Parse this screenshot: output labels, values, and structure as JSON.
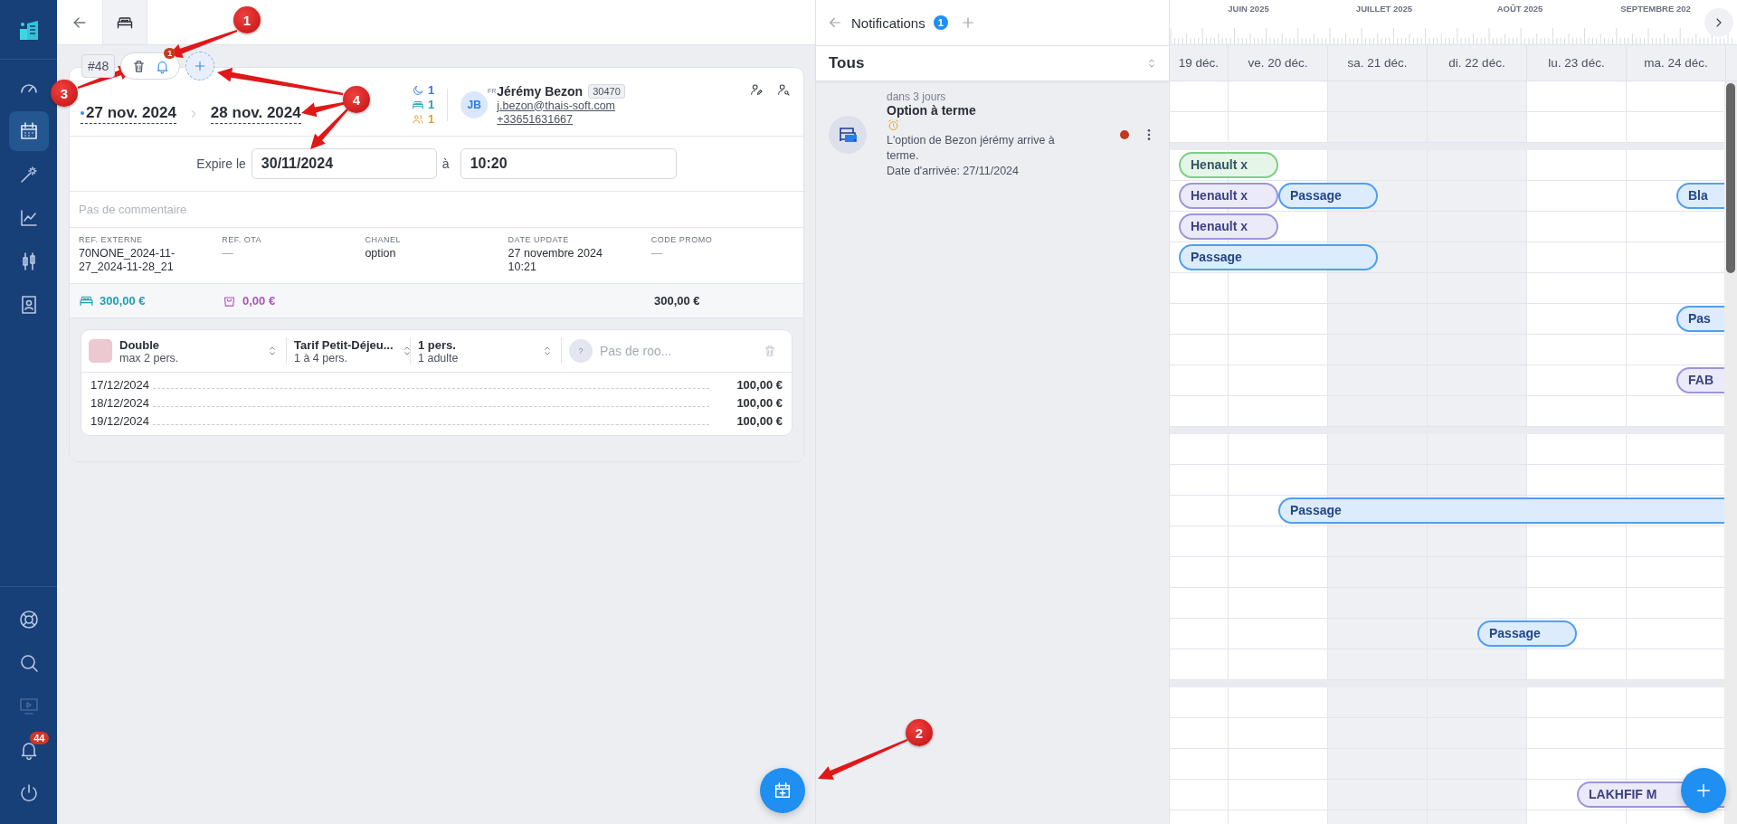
{
  "sidebar": {
    "top": [
      {
        "selected": false
      },
      {
        "selected": true
      },
      {
        "selected": false
      },
      {
        "selected": false
      },
      {
        "selected": false
      },
      {
        "selected": false
      }
    ],
    "bottom": [
      {
        "disabled": false
      },
      {
        "disabled": false
      },
      {
        "disabled": true
      },
      {
        "disabled": false,
        "badge": "44"
      },
      {
        "disabled": false
      }
    ]
  },
  "tabs": [
    {
      "selected": true
    }
  ],
  "booking": {
    "number": "#48",
    "alert_count": "1",
    "arrival": "27 nov. 2024",
    "departure": "28 nov. 2024",
    "nights": "1",
    "rooms": "1",
    "guests": "1",
    "guest": {
      "initials": "JB",
      "country": "FR",
      "name": "Jérémy Bezon",
      "id": "30470",
      "email": "j.bezon@thais-soft.com",
      "phone": "+33651631667"
    },
    "expiry": {
      "label": "Expire le",
      "date": "30/11/2024",
      "at": "à",
      "time": "10:20"
    },
    "comment": {
      "placeholder": "Pas de commentaire"
    },
    "refs": [
      {
        "label": "REF. EXTERNE",
        "value": "70NONE_2024-11-27_2024-11-28_21",
        "muted": false
      },
      {
        "label": "REF. OTA",
        "value": "—",
        "muted": true
      },
      {
        "label": "CHANEL",
        "value": "option",
        "muted": false
      },
      {
        "label": "DATE UPDATE",
        "value": "27 novembre 2024 10:21",
        "muted": false
      },
      {
        "label": "CODE PROMO",
        "value": "—",
        "muted": true
      }
    ],
    "totals": {
      "rooms": "300,00 €",
      "extras": "0,00 €",
      "total": "300,00 €"
    },
    "room_lines": [
      {
        "type": "Double",
        "capacity": "max 2 pers.",
        "rate": "Tarif Petit-Déjeu...",
        "rate_capacity": "1 à 4 pers.",
        "occupancy": "1 pers.",
        "occupancy_detail": "1 adulte",
        "room_mark": "?",
        "room_placeholder": "Pas de roo...",
        "nights": [
          {
            "date": "17/12/2024",
            "price": "100,00 €"
          },
          {
            "date": "18/12/2024",
            "price": "100,00 €"
          },
          {
            "date": "19/12/2024",
            "price": "100,00 €"
          }
        ]
      }
    ]
  },
  "notifications": {
    "title": "Notifications",
    "count": "1",
    "filter": "Tous",
    "items": [
      {
        "when": "dans 3 jours",
        "title": "Option à terme",
        "text": "L'option de Bezon jérémy arrive à terme.",
        "detail": "Date d'arrivée: 27/11/2024",
        "unread": true
      }
    ]
  },
  "calendar": {
    "months": [
      "JUIN 2025",
      "JUILLET 2025",
      "AOÛT 2025",
      "SEPTEMBRE 202"
    ],
    "days": [
      {
        "label": "19 déc.",
        "weekend": false
      },
      {
        "label": "ve. 20 déc.",
        "weekend": false
      },
      {
        "label": "sa. 21 déc.",
        "weekend": true
      },
      {
        "label": "di. 22 déc.",
        "weekend": true
      },
      {
        "label": "lu. 23 déc.",
        "weekend": false
      },
      {
        "label": "ma. 24 déc.",
        "weekend": false
      }
    ],
    "groups": [
      {
        "rows": [
          {},
          {}
        ]
      },
      {
        "rows": [
          {
            "bars": [
              {
                "label": "Henault x",
                "color": "#7ccf86"
              }
            ]
          },
          {
            "bars": [
              {
                "label": "Henault x",
                "color": "#9d95dc"
              },
              {
                "label": "Passage",
                "color": "#4f9ff0"
              },
              {
                "label": "Bla",
                "color": "#4f9ff0"
              }
            ]
          },
          {
            "bars": [
              {
                "label": "Henault x",
                "color": "#9d95dc"
              }
            ]
          },
          {
            "bars": [
              {
                "label": "Passage",
                "color": "#4f9ff0"
              }
            ]
          },
          {},
          {
            "bars": [
              {
                "label": "Pas",
                "color": "#4f9ff0"
              }
            ]
          },
          {},
          {
            "bars": [
              {
                "label": "FAB",
                "color": "#9d95dc"
              }
            ]
          },
          {}
        ]
      },
      {
        "rows": [
          {},
          {},
          {
            "bars": [
              {
                "label": "Passage",
                "color": "#4f9ff0"
              }
            ]
          },
          {},
          {},
          {},
          {
            "bars": [
              {
                "label": "Passage",
                "color": "#4f9ff0"
              }
            ]
          },
          {}
        ]
      },
      {
        "rows": [
          {},
          {},
          {},
          {
            "bars": [
              {
                "label": "LAKHFIF M",
                "color": "#9d95dc"
              }
            ]
          },
          {}
        ]
      }
    ]
  },
  "annotations": [
    "1",
    "2",
    "3",
    "4"
  ]
}
